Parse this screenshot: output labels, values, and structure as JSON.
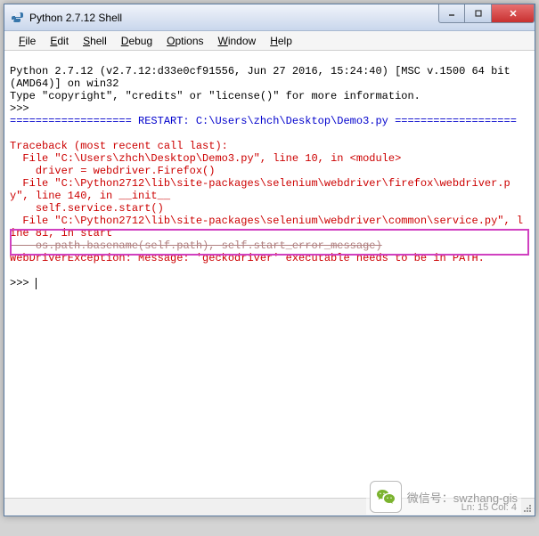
{
  "window": {
    "title": "Python 2.7.12 Shell"
  },
  "menubar": {
    "items": [
      {
        "label": "File",
        "accel": "F"
      },
      {
        "label": "Edit",
        "accel": "E"
      },
      {
        "label": "Shell",
        "accel": "S"
      },
      {
        "label": "Debug",
        "accel": "D"
      },
      {
        "label": "Options",
        "accel": "O"
      },
      {
        "label": "Window",
        "accel": "W"
      },
      {
        "label": "Help",
        "accel": "H"
      }
    ]
  },
  "console": {
    "banner1": "Python 2.7.12 (v2.7.12:d33e0cf91556, Jun 27 2016, 15:24:40) [MSC v.1500 64 bit (AMD64)] on win32",
    "banner2": "Type \"copyright\", \"credits\" or \"license()\" for more information.",
    "prompt1": ">>> ",
    "restart": "=================== RESTART: C:\\Users\\zhch\\Desktop\\Demo3.py ===================",
    "traceback_header": "Traceback (most recent call last):",
    "tb_line1": "  File \"C:\\Users\\zhch\\Desktop\\Demo3.py\", line 10, in <module>",
    "tb_line2": "    driver = webdriver.Firefox()",
    "tb_line3": "  File \"C:\\Python2712\\lib\\site-packages\\selenium\\webdriver\\firefox\\webdriver.py\", line 140, in __init__",
    "tb_line4": "    self.service.start()",
    "tb_line5": "  File \"C:\\Python2712\\lib\\site-packages\\selenium\\webdriver\\common\\service.py\", line 81, in start",
    "tb_line6": "    os.path.basename(self.path), self.start_error_message)",
    "exception": "WebDriverException: Message: 'geckodriver' executable needs to be in PATH. ",
    "prompt2": ">>> "
  },
  "statusbar": {
    "position": "Ln: 15  Col: 4"
  },
  "watermark": {
    "label": "微信号：swzhang-gis"
  }
}
